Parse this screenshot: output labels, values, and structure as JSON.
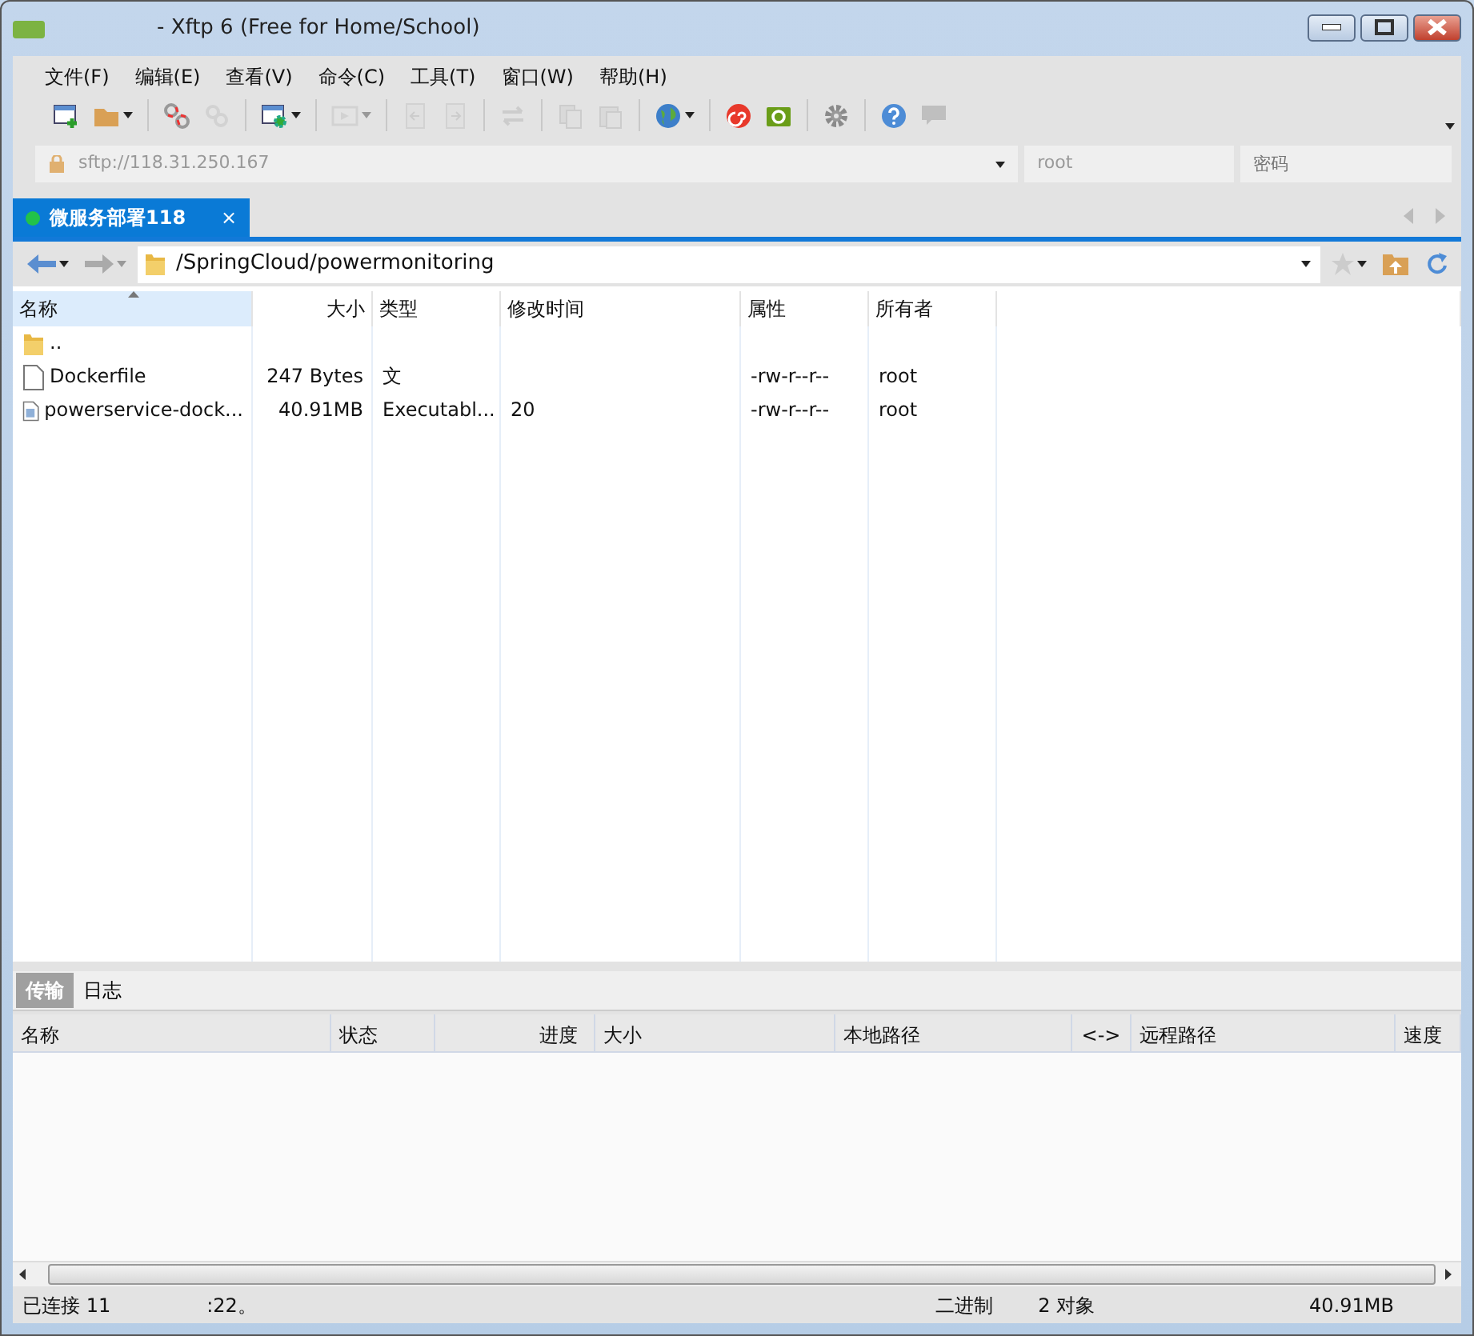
{
  "window": {
    "title": "- Xftp 6 (Free for Home/School)"
  },
  "menu": [
    "文件(F)",
    "编辑(E)",
    "查看(V)",
    "命令(C)",
    "工具(T)",
    "窗口(W)",
    "帮助(H)"
  ],
  "toolbar": [
    {
      "kind": "new-session",
      "disabled": false,
      "dropdown": false
    },
    {
      "kind": "open-folder",
      "disabled": false,
      "dropdown": true
    },
    {
      "kind": "sep"
    },
    {
      "kind": "disconnect",
      "disabled": false,
      "dropdown": false
    },
    {
      "kind": "link",
      "disabled": true,
      "dropdown": false
    },
    {
      "kind": "sep"
    },
    {
      "kind": "properties",
      "disabled": false,
      "dropdown": true
    },
    {
      "kind": "sep"
    },
    {
      "kind": "play",
      "disabled": true,
      "dropdown": true
    },
    {
      "kind": "sep"
    },
    {
      "kind": "doc-left",
      "disabled": true,
      "dropdown": false
    },
    {
      "kind": "doc-right",
      "disabled": true,
      "dropdown": false
    },
    {
      "kind": "sep"
    },
    {
      "kind": "sync",
      "disabled": true,
      "dropdown": false
    },
    {
      "kind": "sep"
    },
    {
      "kind": "copy",
      "disabled": true,
      "dropdown": false
    },
    {
      "kind": "paste",
      "disabled": true,
      "dropdown": false
    },
    {
      "kind": "sep"
    },
    {
      "kind": "globe",
      "disabled": false,
      "dropdown": true
    },
    {
      "kind": "sep"
    },
    {
      "kind": "spiral",
      "disabled": false,
      "dropdown": false
    },
    {
      "kind": "green-folder",
      "disabled": false,
      "dropdown": false
    },
    {
      "kind": "sep"
    },
    {
      "kind": "gear",
      "disabled": false,
      "dropdown": false
    },
    {
      "kind": "sep"
    },
    {
      "kind": "help",
      "disabled": false,
      "dropdown": false
    },
    {
      "kind": "chat",
      "disabled": true,
      "dropdown": false
    }
  ],
  "address": {
    "host": "sftp://118.31.250.167",
    "user": "root",
    "password_placeholder": "密码"
  },
  "session_tabs": [
    {
      "label": "微服务部署118",
      "selected": true,
      "connected": true,
      "close_symbol": "×"
    }
  ],
  "path": "/SpringCloud/powermonitoring",
  "file_table": {
    "columns": [
      "名称",
      "大小",
      "类型",
      "修改时间",
      "属性",
      "所有者"
    ],
    "rows": [
      {
        "kind": "folder",
        "name": ".."
      },
      {
        "kind": "file",
        "name": "Dockerfile",
        "size": "247 Bytes",
        "type": "文",
        "attributes": "-rw-r--r--",
        "owner": "root"
      },
      {
        "kind": "executable",
        "name": "powerservice-dock...",
        "size": "40.91MB",
        "type": "Executabl...",
        "modified": "20",
        "attributes": "-rw-r--r--",
        "owner": "root"
      }
    ]
  },
  "bottom_tabs": [
    {
      "label": "传输",
      "selected": true
    },
    {
      "label": "日志",
      "selected": false
    }
  ],
  "transfer_table": {
    "columns": [
      "名称",
      "状态",
      "进度",
      "大小",
      "本地路径",
      "<->",
      "远程路径",
      "速度"
    ]
  },
  "status_bar": {
    "connection": "已连接 11",
    "port": ":22。",
    "mode": "二进制",
    "objects": "2 对象",
    "size": "40.91MB"
  }
}
